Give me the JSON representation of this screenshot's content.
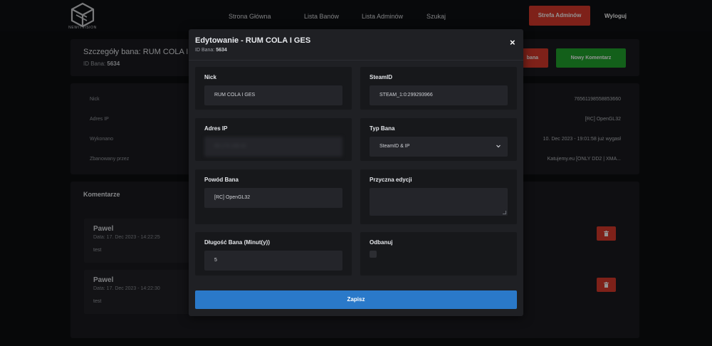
{
  "brand": {
    "logo_text": "NEWITVISION"
  },
  "nav": {
    "items": [
      "Strona Główna",
      "Lista Banów",
      "Lista Adminów",
      "Szukaj"
    ],
    "admin_button": "Strefa Adminów",
    "logout": "Wyloguj"
  },
  "page": {
    "title": "Szczegóły bana: RUM COLA I",
    "id_label": "ID Bana:",
    "id_value": "5634",
    "button_partial": "bana",
    "new_comment_button": "Nowy Komentarz",
    "details": [
      {
        "label": "Nick",
        "value": "76561198558853660"
      },
      {
        "label": "Adres IP",
        "value": "[RC] OpenGL32"
      },
      {
        "label": "Wykonano",
        "value": "10. Dec 2023 - 19:01:58 już wygasł"
      },
      {
        "label": "Zbanowany przez",
        "value": "Katujemy.eu [ONLY DD2 | XMA..."
      }
    ],
    "comments_title": "Komentarze",
    "comments": [
      {
        "author": "Pawel",
        "date": "Data: 17. Dec 2023 - 14:22:25",
        "text": "test"
      },
      {
        "author": "Pawel",
        "date": "Data: 17. Dec 2023 - 14:22:30",
        "text": "test"
      }
    ]
  },
  "modal": {
    "title": "Edytowanie - RUM COLA I GES",
    "id_label": "ID Bana:",
    "id_value": "5634",
    "close": "×",
    "nick": {
      "label": "Nick",
      "value": "RUM COLA I GES"
    },
    "steamid": {
      "label": "SteamID",
      "value": "STEAM_1:0:299293966"
    },
    "ip": {
      "label": "Adres IP",
      "value": "89.174.168.42"
    },
    "ban_type": {
      "label": "Typ Bana",
      "value": "SteamID & IP"
    },
    "reason": {
      "label": "Powód Bana",
      "value": "[RC] OpenGL32"
    },
    "edit_reason": {
      "label": "Przyczna edycji",
      "value": ""
    },
    "length": {
      "label": "Długość Bana (Minut(y))",
      "value": "5"
    },
    "unban": {
      "label": "Odbanuj"
    },
    "save_button": "Zapisz"
  },
  "colors": {
    "danger": "#d93a2b",
    "success": "#22a52d",
    "primary": "#2a79c9"
  }
}
